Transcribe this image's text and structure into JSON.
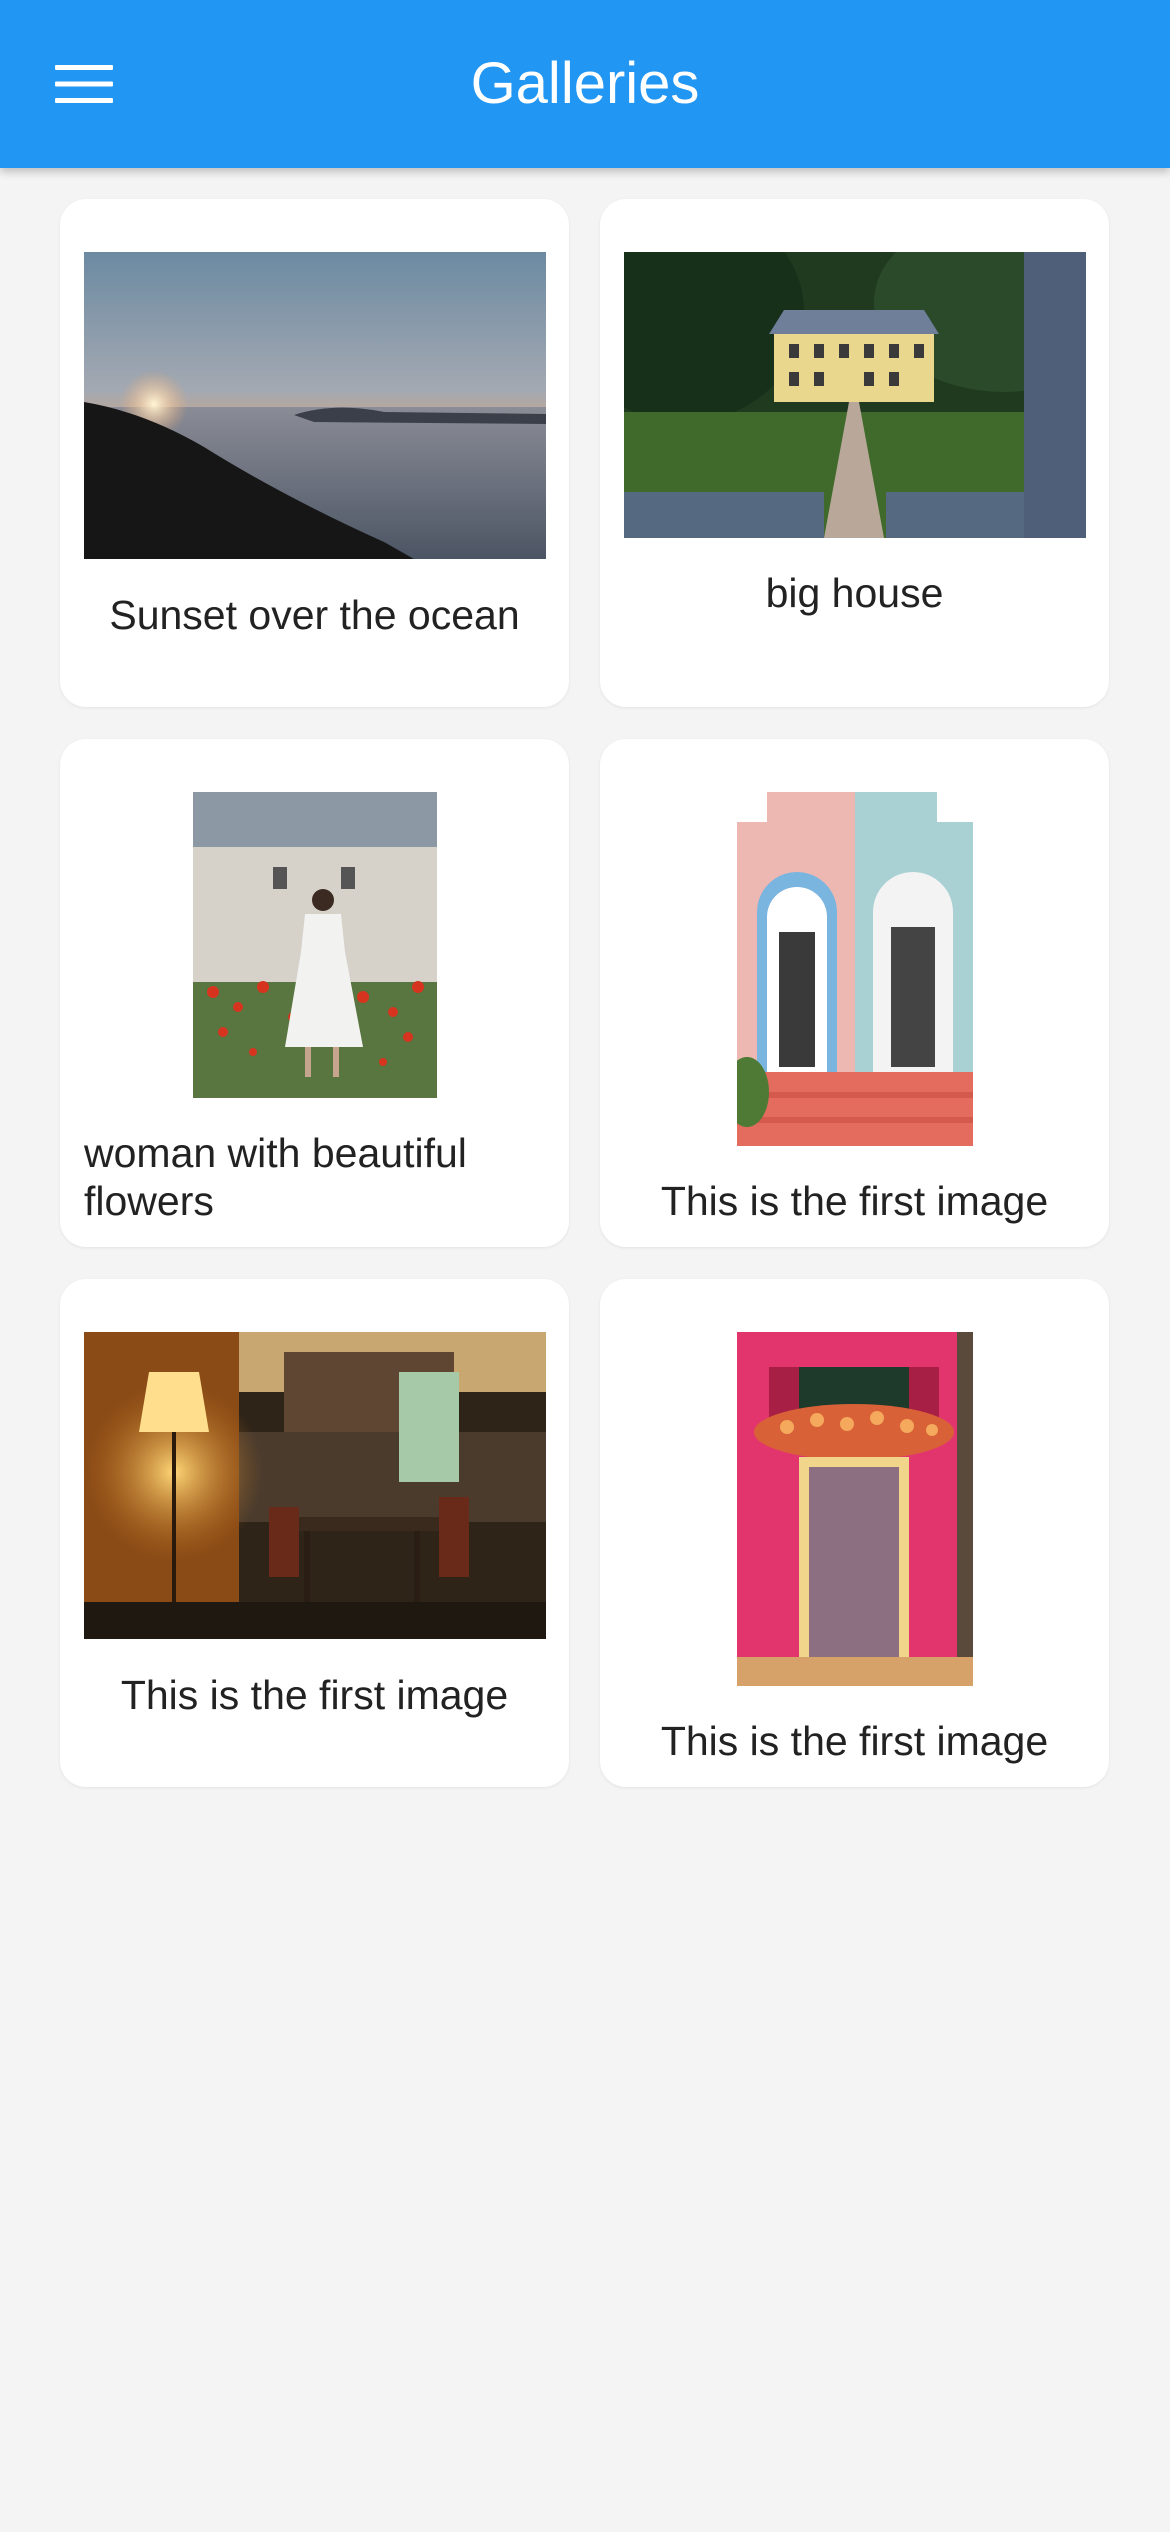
{
  "app_bar": {
    "title": "Galleries",
    "menu_icon": "hamburger-menu-icon",
    "color": "#2196f3"
  },
  "gallery": {
    "items": [
      {
        "caption": "Sunset over the ocean",
        "image": "sunset-ocean-photo"
      },
      {
        "caption": "big house",
        "image": "big-house-photo"
      },
      {
        "caption": "woman with beautiful flowers",
        "image": "woman-flowers-photo"
      },
      {
        "caption": "This is the first image",
        "image": "arched-doors-photo"
      },
      {
        "caption": "This is the first image",
        "image": "kitchen-lamp-photo"
      },
      {
        "caption": "This is the first image",
        "image": "pink-door-photo"
      }
    ]
  }
}
